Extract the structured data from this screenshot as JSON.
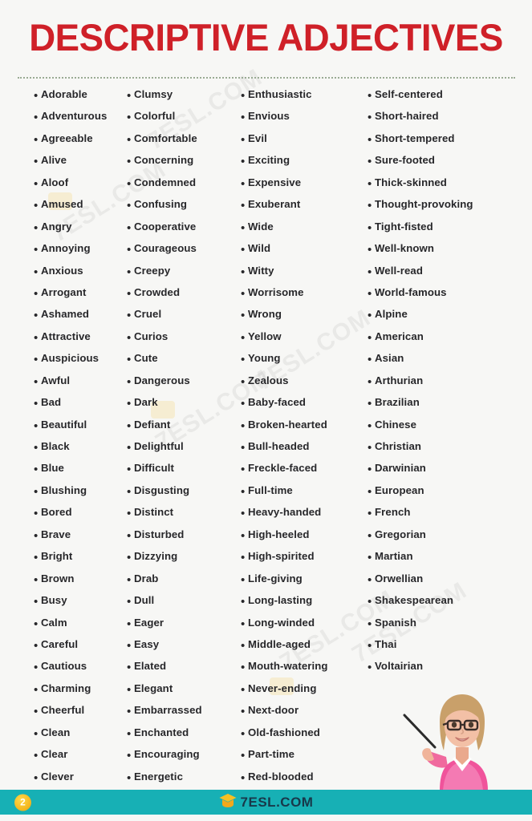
{
  "title": "DESCRIPTIVE ADJECTIVES",
  "theme": {
    "background": "#f7f7f5",
    "title_color": "#cf2028",
    "text_color": "#27272a",
    "divider_color": "#9aab94",
    "footer_bar_color": "#17b0b5",
    "badge_color": "#f5b921",
    "brand_text_color": "#18384a"
  },
  "columns": [
    {
      "items": [
        "Adorable",
        "Adventurous",
        "Agreeable",
        "Alive",
        "Aloof",
        "Amused",
        "Angry",
        "Annoying",
        "Anxious",
        "Arrogant",
        "Ashamed",
        "Attractive",
        "Auspicious",
        "Awful",
        "Bad",
        "Beautiful",
        "Black",
        "Blue",
        "Blushing",
        "Bored",
        "Brave",
        "Bright",
        "Brown",
        "Busy",
        "Calm",
        "Careful",
        "Cautious",
        "Charming",
        "Cheerful",
        "Clean",
        "Clear",
        "Clever"
      ]
    },
    {
      "items": [
        "Clumsy",
        "Colorful",
        "Comfortable",
        "Concerning",
        "Condemned",
        "Confusing",
        "Cooperative",
        "Courageous",
        "Creepy",
        "Crowded",
        "Cruel",
        "Curios",
        "Cute",
        "Dangerous",
        "Dark",
        "Defiant",
        "Delightful",
        "Difficult",
        "Disgusting",
        "Distinct",
        "Disturbed",
        "Dizzying",
        "Drab",
        "Dull",
        "Eager",
        "Easy",
        "Elated",
        "Elegant",
        "Embarrassed",
        "Enchanted",
        "Encouraging",
        "Energetic"
      ]
    },
    {
      "items": [
        "Enthusiastic",
        "Envious",
        "Evil",
        "Exciting",
        "Expensive",
        "Exuberant",
        "Wide",
        "Wild",
        "Witty",
        "Worrisome",
        "Wrong",
        "Yellow",
        "Young",
        "Zealous",
        "Baby-faced",
        "Broken-hearted",
        "Bull-headed",
        "Freckle-faced",
        "Full-time",
        "Heavy-handed",
        "High-heeled",
        "High-spirited",
        "Life-giving",
        "Long-lasting",
        "Long-winded",
        "Middle-aged",
        "Mouth-watering",
        "Never-ending",
        "Next-door",
        "Old-fashioned",
        "Part-time",
        "Red-blooded"
      ]
    },
    {
      "items": [
        "Self-centered",
        "Short-haired",
        "Short-tempered",
        "Sure-footed",
        "Thick-skinned",
        "Thought-provoking",
        "Tight-fisted",
        "Well-known",
        "Well-read",
        "World-famous",
        "Alpine",
        "American",
        "Asian",
        "Arthurian",
        "Brazilian",
        "Chinese",
        "Christian",
        "Darwinian",
        "European",
        "French",
        "Gregorian",
        "Martian",
        "Orwellian",
        "Shakespearean",
        "Spanish",
        "Thai",
        "Voltairian"
      ]
    }
  ],
  "bullet_glyph": "•",
  "watermarks": [
    "7ESL.COM",
    "7ESL.COM",
    "7ESL.COM",
    "7ESL.COM",
    "7ESL.COM",
    "7ESL.COM"
  ],
  "footer": {
    "page_number": "2",
    "brand": "7ESL.COM",
    "logo_icon": "graduation-cap-icon"
  },
  "illustration": {
    "name": "cartoon-teacher-with-pointer"
  }
}
